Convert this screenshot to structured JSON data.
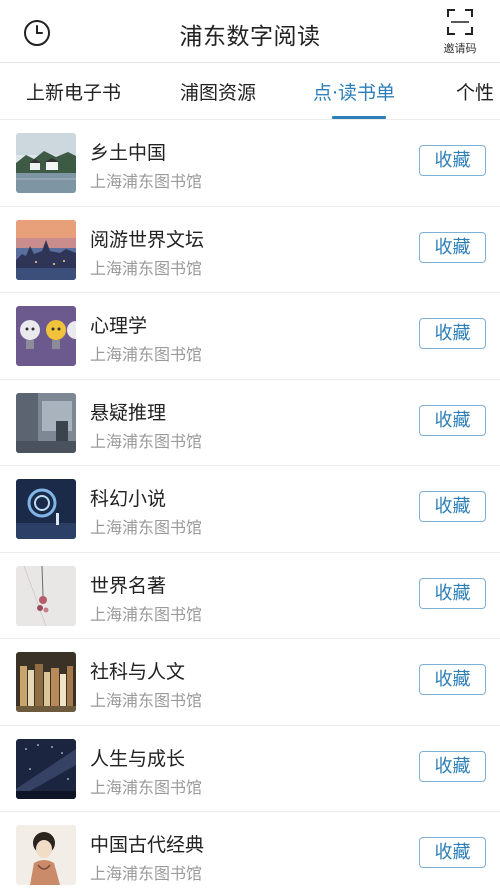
{
  "header": {
    "title": "浦东数字阅读",
    "invite_label": "邀请码",
    "history_icon": "clock-icon",
    "invite_icon": "scan-frame-icon"
  },
  "tabs": [
    {
      "label": "上新电子书",
      "active": false
    },
    {
      "label": "浦图资源",
      "active": false
    },
    {
      "label": "点·读书单",
      "active": true
    },
    {
      "label": "个性",
      "active": false
    }
  ],
  "colors": {
    "accent": "#2e7fb8",
    "button_border": "#7fb0d6",
    "subtitle": "#9a9a9a"
  },
  "list": [
    {
      "title": "乡土中国",
      "subtitle": "上海浦东图书馆",
      "button": "收藏"
    },
    {
      "title": "阅游世界文坛",
      "subtitle": "上海浦东图书馆",
      "button": "收藏"
    },
    {
      "title": "心理学",
      "subtitle": "上海浦东图书馆",
      "button": "收藏"
    },
    {
      "title": "悬疑推理",
      "subtitle": "上海浦东图书馆",
      "button": "收藏"
    },
    {
      "title": "科幻小说",
      "subtitle": "上海浦东图书馆",
      "button": "收藏"
    },
    {
      "title": "世界名著",
      "subtitle": "上海浦东图书馆",
      "button": "收藏"
    },
    {
      "title": "社科与人文",
      "subtitle": "上海浦东图书馆",
      "button": "收藏"
    },
    {
      "title": "人生与成长",
      "subtitle": "上海浦东图书馆",
      "button": "收藏"
    },
    {
      "title": "中国古代经典",
      "subtitle": "上海浦东图书馆",
      "button": "收藏"
    }
  ]
}
